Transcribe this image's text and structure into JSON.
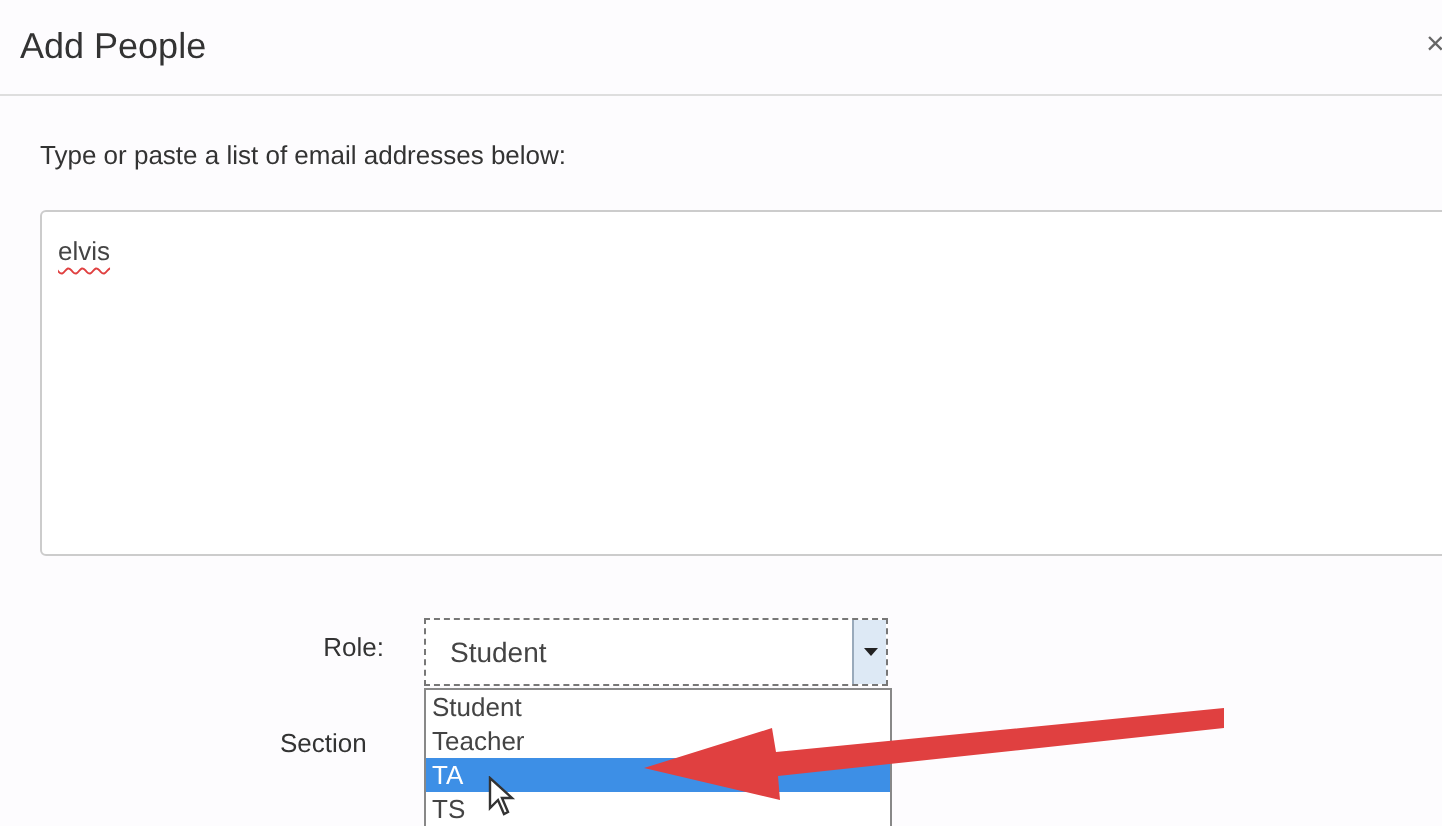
{
  "dialog": {
    "title": "Add People",
    "close": "×"
  },
  "instructions": "Type or paste a list of email addresses below:",
  "emails": {
    "value": "elvis"
  },
  "role": {
    "label": "Role:",
    "value": "Student",
    "options": [
      {
        "label": "Student",
        "highlighted": false
      },
      {
        "label": "Teacher",
        "highlighted": false
      },
      {
        "label": "TA",
        "highlighted": true
      },
      {
        "label": "TS",
        "highlighted": false
      }
    ]
  },
  "section": {
    "label": "Section"
  }
}
